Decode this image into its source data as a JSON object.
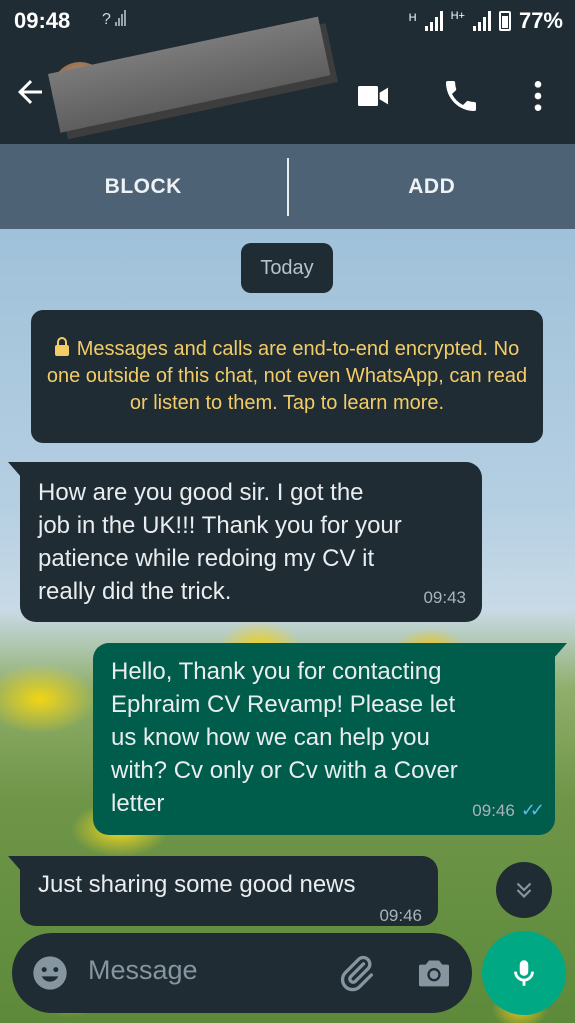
{
  "status_bar": {
    "time": "09:48",
    "signal_text": "?",
    "network_h": "H",
    "network_hplus": "H+",
    "battery": "77%"
  },
  "app_bar": {
    "back_icon": "arrow-left-icon",
    "video_icon": "video-call-icon",
    "call_icon": "phone-icon",
    "more_icon": "more-vert-icon"
  },
  "actions": {
    "block_label": "BLOCK",
    "add_label": "ADD"
  },
  "chat": {
    "date_chip": "Today",
    "encryption_notice": "Messages and calls are end-to-end encrypted. No one outside of this chat, not even WhatsApp, can read or listen to them. Tap to learn more.",
    "messages": [
      {
        "direction": "incoming",
        "text": "How are you good sir. I got the\njob in the UK!!! Thank you for your\npatience while redoing my CV it\nreally did the trick.",
        "time": "09:43"
      },
      {
        "direction": "outgoing",
        "text": "Hello, Thank you for contacting\nEphraim CV Revamp! Please let\nus know how we can help you\nwith? Cv only or Cv with a Cover\nletter",
        "time": "09:46",
        "status": "read"
      },
      {
        "direction": "incoming",
        "text": "Just sharing some good news",
        "time": "09:46"
      }
    ]
  },
  "composer": {
    "placeholder": "Message",
    "emoji_icon": "emoji-icon",
    "attach_icon": "paperclip-icon",
    "camera_icon": "camera-icon",
    "mic_icon": "microphone-icon"
  },
  "colors": {
    "header": "#1f2c34",
    "action_bar": "#4e6276",
    "outgoing_bubble": "#005c4b",
    "incoming_bubble": "#1f2c34",
    "notice_text": "#f3cc66",
    "mic_button": "#00a884",
    "read_ticks": "#53bdeb"
  }
}
